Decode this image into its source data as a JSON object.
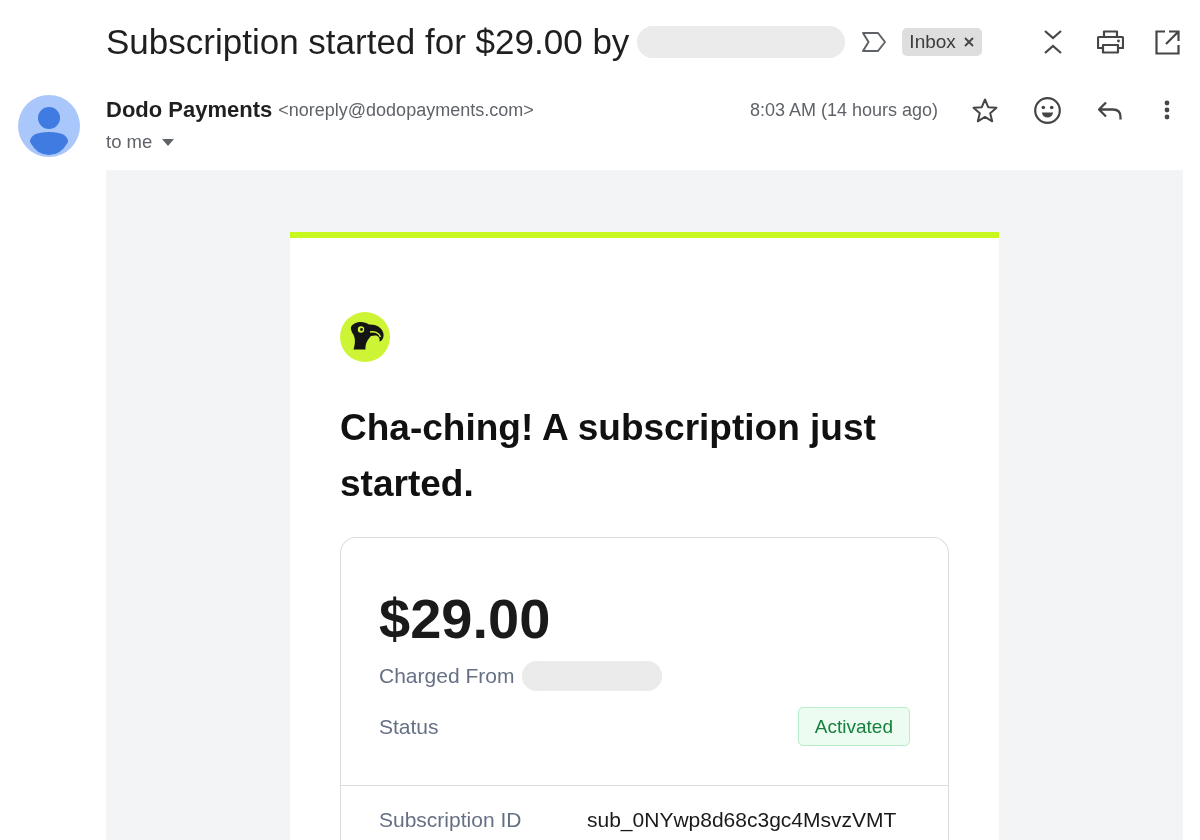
{
  "message": {
    "subject": "Subscription started for $29.00 by",
    "subject_redacted": true,
    "important": false,
    "labels": [
      {
        "text": "Inbox"
      }
    ]
  },
  "sender": {
    "name": "Dodo Payments",
    "email": "<noreply@dodopayments.com>",
    "recipient": "to me",
    "time": "8:03 AM (14 hours ago)",
    "starred": false
  },
  "email_body": {
    "heading": "Cha-ching! A subscription just started.",
    "amount": "$29.00",
    "charged_from": "Charged From",
    "charged_from_redacted": true,
    "status_label": "Status",
    "status": {
      "text": "Activated",
      "kind": "success"
    },
    "details": [
      {
        "label": "Subscription ID",
        "value": "sub_0NYwp8d68c3gc4MsvzVMT"
      }
    ]
  }
}
